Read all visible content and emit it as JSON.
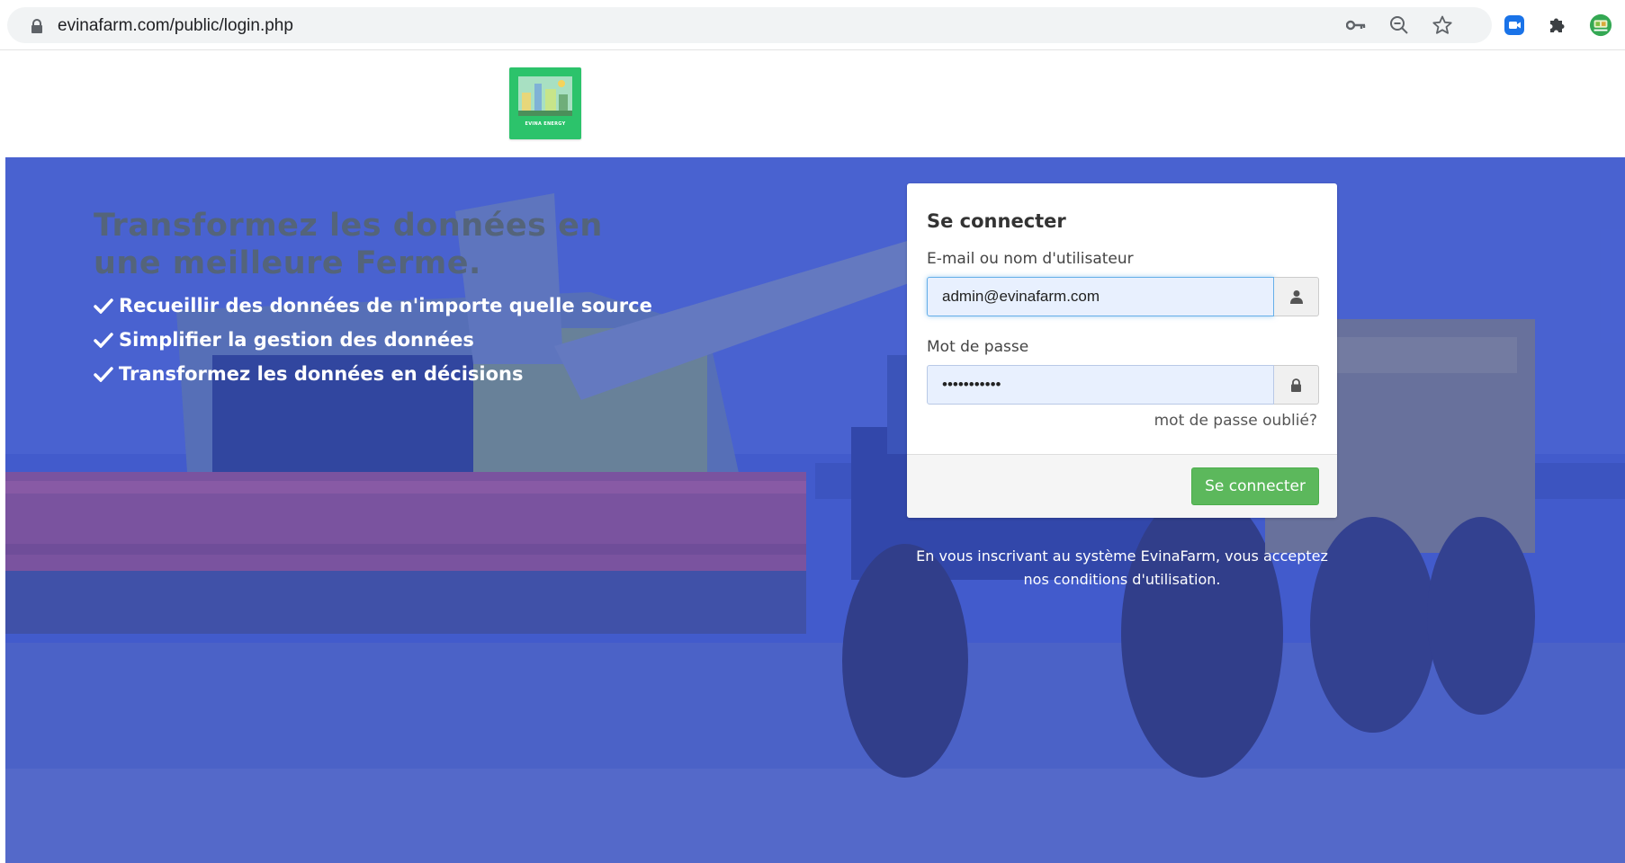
{
  "browser": {
    "url": "evinafarm.com/public/login.php",
    "icons": [
      "lock-icon",
      "key-icon",
      "zoom-icon",
      "star-icon",
      "meet-extension-icon",
      "puzzle-extension-icon",
      "profile-avatar-icon"
    ]
  },
  "logo": {
    "text": "EVINA ENERGY",
    "bg_color": "#2cc36b"
  },
  "hero": {
    "headline": "Transformez les données en une meilleure Ferme.",
    "features": [
      "Recueillir des données de n'importe quelle source",
      "Simplifier la gestion des données",
      "Transformez les données en décisions"
    ],
    "overlay_color": "#3a52cd"
  },
  "login": {
    "title": "Se connecter",
    "email_label": "E-mail ou nom d'utilisateur",
    "email_value": "admin@evinafarm.com",
    "password_label": "Mot de passe",
    "password_value": "tractor1234",
    "forgot_link": "mot de passe oublié?",
    "submit_label": "Se connecter",
    "submit_color": "#5cb85c"
  },
  "terms": {
    "prefix": "En vous inscrivant au système EvinaFarm, vous acceptez ",
    "link": "nos conditions d'utilisation",
    "suffix": "."
  }
}
